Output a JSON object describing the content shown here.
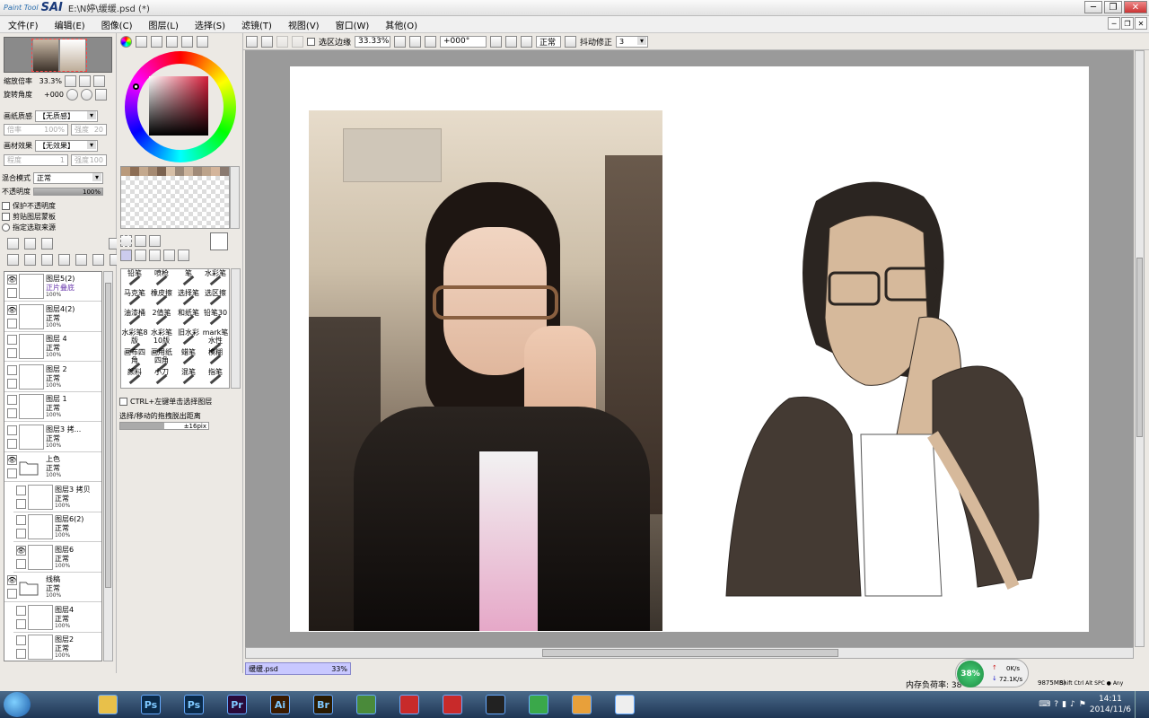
{
  "window": {
    "app_logo_small": "Paint Tool",
    "app_logo_big": "SAI",
    "title": "E:\\N婷\\缓缓.psd (*)"
  },
  "menu": [
    "文件(F)",
    "编辑(E)",
    "图像(C)",
    "图层(L)",
    "选择(S)",
    "滤镜(T)",
    "视图(V)",
    "窗口(W)",
    "其他(O)"
  ],
  "navigator": {
    "zoom_label": "缩放倍率",
    "zoom_value": "33.3%",
    "rotate_label": "旋转角度",
    "rotate_value": "+000"
  },
  "paper": {
    "texture_label": "画纸质感",
    "texture_value": "【无质感】",
    "scale_label": "倍率",
    "scale_value": "100%",
    "strength_label": "强度",
    "strength_value": "20",
    "effect_label": "画材效果",
    "effect_value": "【无效果】",
    "degree_label": "程度",
    "degree_value": "1",
    "strength2_label": "强度",
    "strength2_value": "100"
  },
  "blend": {
    "mode_label": "混合模式",
    "mode_value": "正常",
    "opacity_label": "不透明度",
    "opacity_value": "100%",
    "opt1": "保护不透明度",
    "opt2": "剪贴图层蒙板",
    "opt3": "指定选取来源"
  },
  "layers": [
    {
      "name": "图层5(2)",
      "mode": "正片叠底",
      "opacity": "100%",
      "visible": true
    },
    {
      "name": "图层4(2)",
      "mode": "正常",
      "opacity": "100%",
      "visible": true
    },
    {
      "name": "图层 4",
      "mode": "正常",
      "opacity": "100%",
      "visible": false
    },
    {
      "name": "图层 2",
      "mode": "正常",
      "opacity": "100%",
      "visible": false
    },
    {
      "name": "图层 1",
      "mode": "正常",
      "opacity": "100%",
      "visible": false
    },
    {
      "name": "图层3 拷...",
      "mode": "正常",
      "opacity": "100%",
      "visible": false
    },
    {
      "name": "上色",
      "mode": "正常",
      "opacity": "100%",
      "visible": true,
      "folder": true
    },
    {
      "name": "图层3 拷贝",
      "mode": "正常",
      "opacity": "100%",
      "visible": false
    },
    {
      "name": "图层6(2)",
      "mode": "正常",
      "opacity": "100%",
      "visible": false
    },
    {
      "name": "图层6",
      "mode": "正常",
      "opacity": "100%",
      "visible": true
    },
    {
      "name": "线稿",
      "mode": "正常",
      "opacity": "100%",
      "visible": true,
      "folder": true
    },
    {
      "name": "图层4",
      "mode": "正常",
      "opacity": "100%",
      "visible": false
    },
    {
      "name": "图层2",
      "mode": "正常",
      "opacity": "100%",
      "visible": false
    }
  ],
  "swatch_colors": [
    "#b99a7c",
    "#8d6e55",
    "#c4a98e",
    "#a58a72",
    "#7b624f",
    "#d6bfa7",
    "#9a8878",
    "#cbb39c",
    "#a08a78",
    "#bca38b",
    "#d4b59b",
    "#8a7a70"
  ],
  "brushes": [
    [
      "铅笔",
      "喷枪",
      "笔",
      "水彩笔"
    ],
    [
      "马克笔",
      "橡皮擦",
      "选择笔",
      "选区擦"
    ],
    [
      "油漆桶",
      "2值笔",
      "和纸笔",
      "铅笔30"
    ],
    [
      "水彩笔8版",
      "水彩笔10版",
      "旧水彩",
      "mark笔水性"
    ],
    [
      "画布四角",
      "画用纸四角",
      "蜡笔",
      "模糊"
    ],
    [
      "颜料",
      "小刀",
      "混笔",
      "指笔"
    ]
  ],
  "ctrl_option": "CTRL+左键单击选择图层",
  "move_label": "选择/移动的拖拽脱出距离",
  "move_value": "±16pix",
  "canvas_toolbar": {
    "sel_edge": "选区边缘",
    "zoom": "33.33%",
    "angle": "+000°",
    "mode": "正常",
    "stabilizer_label": "抖动修正",
    "stabilizer_value": "3"
  },
  "file_tab": {
    "name": "缓缓.psd",
    "zoom": "33%"
  },
  "status": {
    "memory": "内存负荷率: 38",
    "mem_tail": "9875MB)",
    "shortcut": "Shift Ctrl Alt SPC ● Any"
  },
  "net": {
    "percent": "38%",
    "up": "0K/s",
    "down": "72.1K/s"
  },
  "clock": {
    "time": "14:11",
    "date": "2014/11/6"
  },
  "taskbar": [
    {
      "label": "",
      "color": "#e8c04a"
    },
    {
      "label": "Ps",
      "color": "#0a2a4a"
    },
    {
      "label": "Ps",
      "color": "#0a2a4a"
    },
    {
      "label": "Pr",
      "color": "#2a0a3a"
    },
    {
      "label": "Ai",
      "color": "#3a1a00"
    },
    {
      "label": "Br",
      "color": "#2a1a00"
    },
    {
      "label": "",
      "color": "#4a8a3a"
    },
    {
      "label": "",
      "color": "#c82a2a"
    },
    {
      "label": "",
      "color": "#c82a2a"
    },
    {
      "label": "",
      "color": "#222"
    },
    {
      "label": "",
      "color": "#3aa84a"
    },
    {
      "label": "",
      "color": "#e8a03a"
    },
    {
      "label": "",
      "color": "#eee"
    }
  ]
}
